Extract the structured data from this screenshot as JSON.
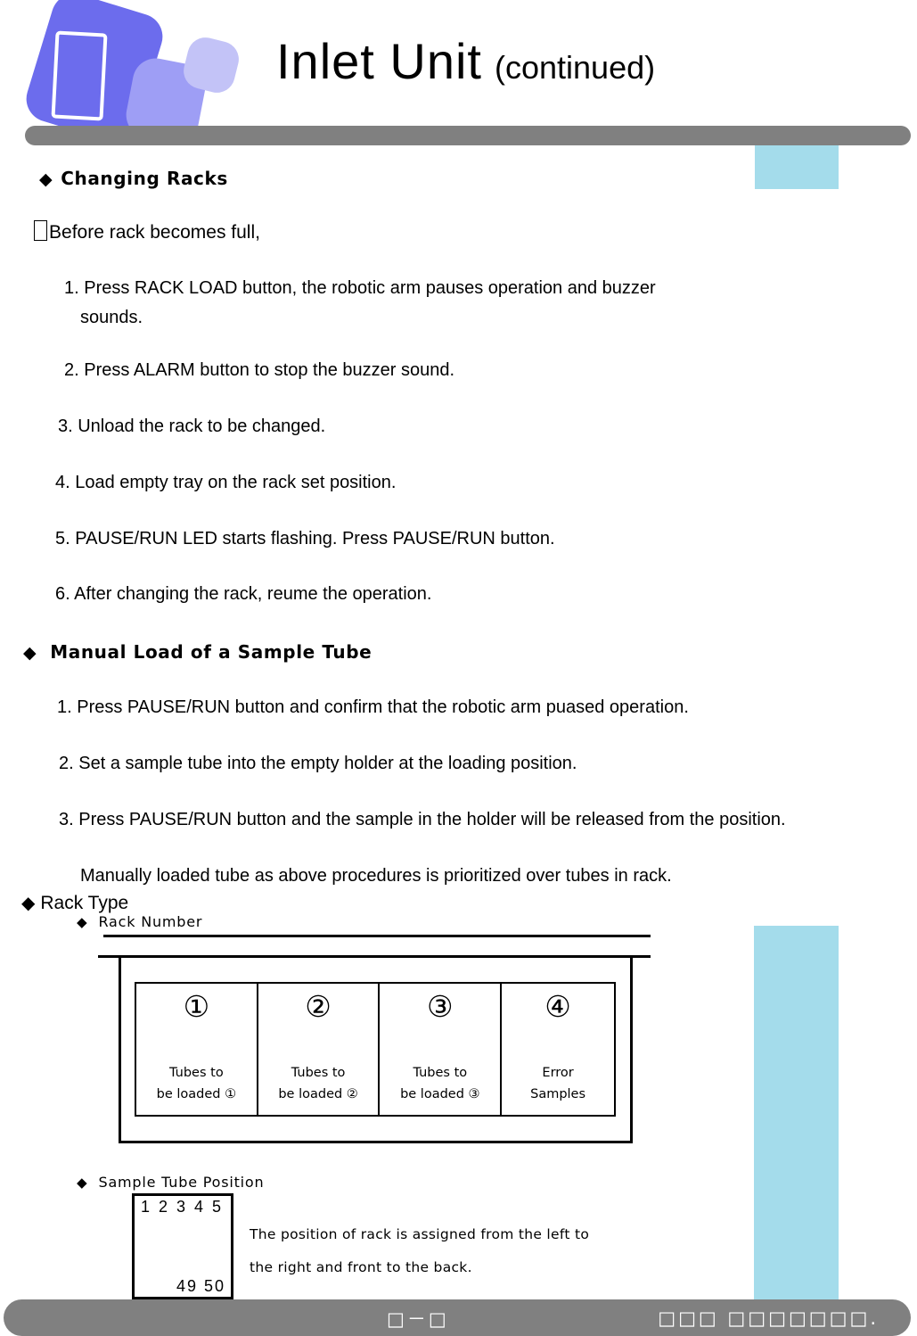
{
  "header": {
    "title_main": "Inlet Unit",
    "title_suffix": "(continued)",
    "logo_colors": {
      "dark": "#6c6ced",
      "mid": "#9e9ef5",
      "light": "#c3c3f7"
    },
    "bar_color": "#808080"
  },
  "accents": {
    "color": "#a4dceb"
  },
  "sections": {
    "changing_racks": {
      "bullet": "◆",
      "heading": "Changing Racks",
      "lead": "Before rack becomes full,",
      "steps": [
        "1. Press RACK LOAD button, the robotic arm pauses operation and buzzer",
        "sounds.",
        "2. Press ALARM button to stop the buzzer sound.",
        "3. Unload the rack to be changed.",
        "4. Load empty tray on the rack set position.",
        "5. PAUSE/RUN LED starts flashing. Press PAUSE/RUN button.",
        "6. After changing the rack, reume the operation."
      ]
    },
    "manual_load": {
      "bullet": "◆",
      "heading": "Manual Load of a Sample Tube",
      "steps": [
        "1. Press PAUSE/RUN button and confirm that the robotic arm puased operation.",
        "2. Set a sample tube into the empty holder at the loading position.",
        "3. Press PAUSE/RUN button and the sample in the holder will  be released from the position."
      ],
      "note": "Manually loaded tube as above procedures is prioritized over tubes in rack."
    },
    "rack_type": {
      "bullet": "◆",
      "heading": "Rack Type",
      "rack_number": {
        "bullet": "◆",
        "heading": "Rack Number",
        "cells": [
          {
            "number": "①",
            "line1": "Tubes to",
            "line2": "be loaded ①"
          },
          {
            "number": "②",
            "line1": "Tubes to",
            "line2": "be loaded ②"
          },
          {
            "number": "③",
            "line1": "Tubes to",
            "line2": "be loaded ③"
          },
          {
            "number": "④",
            "line1": "Error",
            "line2": "Samples"
          }
        ]
      },
      "sample_tube_position": {
        "bullet": "◆",
        "heading": "Sample Tube Position",
        "first_row": "1 2 3 4 5",
        "last_row": "49 50",
        "description_line1": "The position of rack is assigned from the left to",
        "description_line2": "the right and front to the back."
      }
    }
  },
  "footer": {
    "page_number": "□－□",
    "note": "□□□ □□□□□□□."
  }
}
